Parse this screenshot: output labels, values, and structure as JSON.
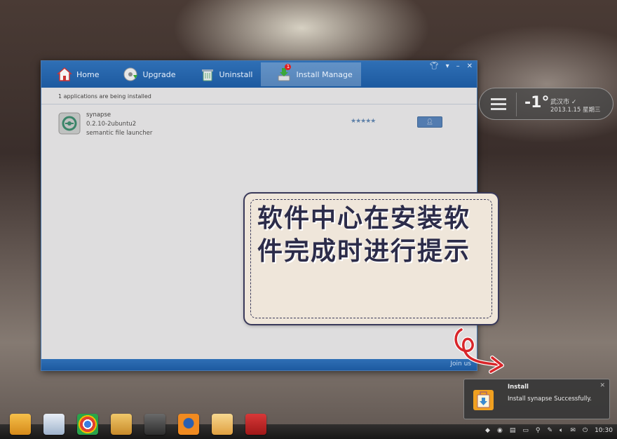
{
  "window": {
    "toolbar": {
      "items": [
        {
          "label": "Home",
          "icon": "home-icon"
        },
        {
          "label": "Upgrade",
          "icon": "upgrade-disc-icon"
        },
        {
          "label": "Uninstall",
          "icon": "trash-icon"
        },
        {
          "label": "Install Manage",
          "icon": "download-icon",
          "badge": "1"
        }
      ]
    },
    "status": "1 applications are being installed",
    "app": {
      "name": "synapse",
      "version": "0.2.10-2ubuntu2",
      "description": "semantic file launcher",
      "rating_stars": 5,
      "rating_text": "★★★★★"
    },
    "footer_link": "Join us"
  },
  "weather": {
    "temperature": "-1°",
    "city": "武汉市 ✓",
    "date": "2013.1.15 星期三"
  },
  "note": {
    "text": "软件中心在安装软件完成时进行提示"
  },
  "notification": {
    "title": "Install",
    "message": "Install synapse Successfully."
  },
  "dock": {
    "items": [
      "media-player-icon",
      "software-center-icon",
      "chrome-icon",
      "ubuntu-tweak-icon",
      "gears-icon",
      "firefox-icon",
      "installer-icon",
      "terminal-icon"
    ]
  },
  "tray": {
    "clock": "10:30"
  },
  "colors": {
    "toolbar_blue": "#2f6fb5",
    "note_bg": "#efe6da",
    "arrow_red": "#d8262a"
  }
}
